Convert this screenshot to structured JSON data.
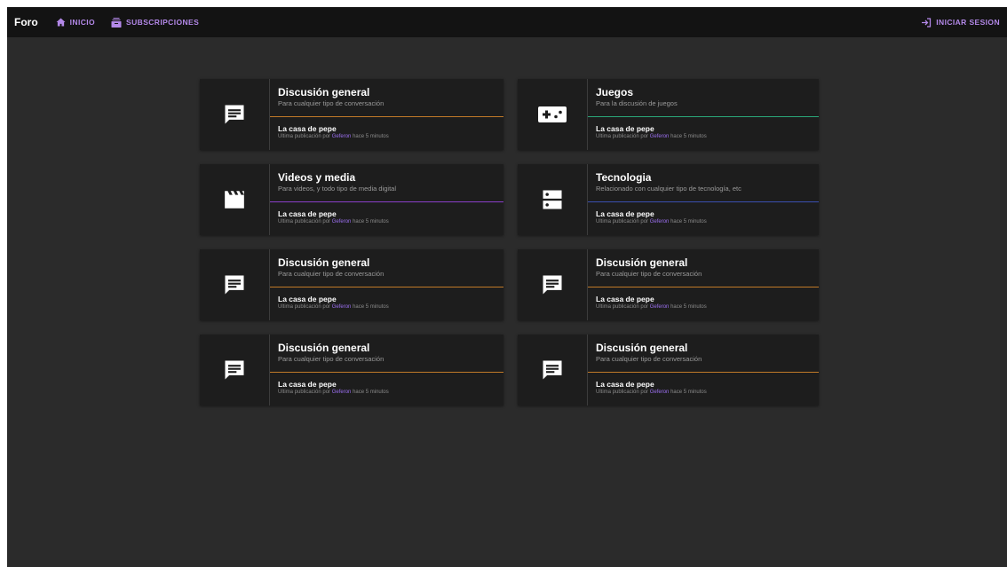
{
  "nav": {
    "brand": "Foro",
    "home": "INICIO",
    "subscriptions": "SUBSCRIPCIONES",
    "login": "INICIAR SESION"
  },
  "accent": "#b388e8",
  "forums": [
    {
      "icon": "chat-icon",
      "title": "Discusión general",
      "subtitle": "Para cualquier tipo de conversación",
      "accent_color": "#c17a28",
      "last_title": "La casa de pepe",
      "last_prefix": "Ultima publicación por",
      "last_author": "Geferon",
      "last_time": "hace 5 minutos"
    },
    {
      "icon": "gamepad-icon",
      "title": "Juegos",
      "subtitle": "Para la discusión de juegos",
      "accent_color": "#2aa87a",
      "last_title": "La casa de pepe",
      "last_prefix": "Ultima publicación por",
      "last_author": "Geferon",
      "last_time": "hace 5 minutos"
    },
    {
      "icon": "clapperboard-icon",
      "title": "Videos y media",
      "subtitle": "Para videos, y todo tipo de media digital",
      "accent_color": "#8a3fc9",
      "last_title": "La casa de pepe",
      "last_prefix": "Ultima publicación por",
      "last_author": "Geferon",
      "last_time": "hace 5 minutos"
    },
    {
      "icon": "server-icon",
      "title": "Tecnologia",
      "subtitle": "Relacionado con cualquier tipo de tecnología, etc",
      "accent_color": "#3a4fb0",
      "last_title": "La casa de pepe",
      "last_prefix": "Ultima publicación por",
      "last_author": "Geferon",
      "last_time": "hace 5 minutos"
    },
    {
      "icon": "chat-icon",
      "title": "Discusión general",
      "subtitle": "Para cualquier tipo de conversación",
      "accent_color": "#c17a28",
      "last_title": "La casa de pepe",
      "last_prefix": "Ultima publicación por",
      "last_author": "Geferon",
      "last_time": "hace 5 minutos"
    },
    {
      "icon": "chat-icon",
      "title": "Discusión general",
      "subtitle": "Para cualquier tipo de conversación",
      "accent_color": "#c17a28",
      "last_title": "La casa de pepe",
      "last_prefix": "Ultima publicación por",
      "last_author": "Geferon",
      "last_time": "hace 5 minutos"
    },
    {
      "icon": "chat-icon",
      "title": "Discusión general",
      "subtitle": "Para cualquier tipo de conversación",
      "accent_color": "#c17a28",
      "last_title": "La casa de pepe",
      "last_prefix": "Ultima publicación por",
      "last_author": "Geferon",
      "last_time": "hace 5 minutos"
    },
    {
      "icon": "chat-icon",
      "title": "Discusión general",
      "subtitle": "Para cualquier tipo de conversación",
      "accent_color": "#c17a28",
      "last_title": "La casa de pepe",
      "last_prefix": "Ultima publicación por",
      "last_author": "Geferon",
      "last_time": "hace 5 minutos"
    }
  ]
}
